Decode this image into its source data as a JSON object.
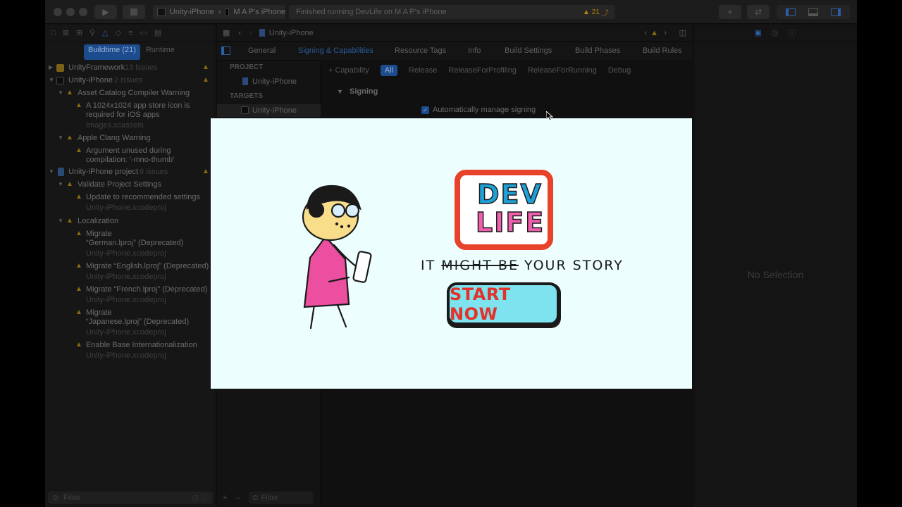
{
  "toolbar": {
    "scheme_target": "Unity-iPhone",
    "scheme_device": "M A P's iPhone",
    "status": "Finished running DevLife on M A P's iPhone",
    "warning_count": "21"
  },
  "navigator": {
    "segments": [
      "Buildtime (21)",
      "Runtime"
    ],
    "groups": [
      {
        "title": "UnityFramework",
        "count": "13 issues"
      },
      {
        "title": "Unity-iPhone",
        "count": "2 issues"
      },
      {
        "title": "Asset Catalog Compiler Warning"
      },
      {
        "title": "A 1024x1024 app store icon is",
        "title2": "required for iOS apps",
        "file": "Images.xcassets"
      },
      {
        "title": "Apple Clang Warning"
      },
      {
        "title": "Argument unused during",
        "title2": "compilation: '-mno-thumb'"
      },
      {
        "title": "Unity-iPhone project",
        "count": "6 issues"
      },
      {
        "title": "Validate Project Settings"
      },
      {
        "title": "Update to recommended settings",
        "file": "Unity-iPhone.xcodeproj"
      },
      {
        "title": "Localization"
      },
      {
        "title": "Migrate",
        "title2": "“German.lproj” (Deprecated)",
        "file": "Unity-iPhone.xcodeproj"
      },
      {
        "title": "Migrate “English.lproj” (Deprecated)",
        "file": "Unity-iPhone.xcodeproj"
      },
      {
        "title": "Migrate “French.lproj” (Deprecated)",
        "file": "Unity-iPhone.xcodeproj"
      },
      {
        "title": "Migrate",
        "title2": "“Japanese.lproj” (Deprecated)",
        "file": "Unity-iPhone.xcodeproj"
      },
      {
        "title": "Enable Base Internationalization",
        "file": "Unity-iPhone.xcodeproj"
      }
    ],
    "filter_placeholder": "Filter"
  },
  "editor": {
    "breadcrumb": "Unity-iPhone",
    "tabs": [
      "General",
      "Signing & Capabilities",
      "Resource Tags",
      "Info",
      "Build Settings",
      "Build Phases",
      "Build Rules"
    ],
    "project_header": "PROJECT",
    "project_item": "Unity-iPhone",
    "targets_header": "TARGETS",
    "target_item": "Unity-iPhone",
    "capability_button": "Capability",
    "configs": [
      "All",
      "Release",
      "ReleaseForProfiling",
      "ReleaseForRunning",
      "Debug"
    ],
    "signing_title": "Signing",
    "auto_sign_label": "Automatically manage signing",
    "filter_placeholder": "Filter"
  },
  "inspector": {
    "empty_text": "No Selection"
  },
  "splash": {
    "logo_line1": "DEV",
    "logo_line2": "LIFE",
    "tagline_start": "IT",
    "tagline_struck": "MIGHT BE",
    "tagline_end": "YOUR STORY",
    "start_label": "START NOW",
    "colors": {
      "background": "#ecfefe",
      "logo_border": "#e8422a",
      "logo_dev": "#1fa0d6",
      "logo_life": "#ef5fae",
      "button_fill": "#7fe3ef",
      "button_text": "#e2322a",
      "dress": "#ec4f9f"
    }
  }
}
